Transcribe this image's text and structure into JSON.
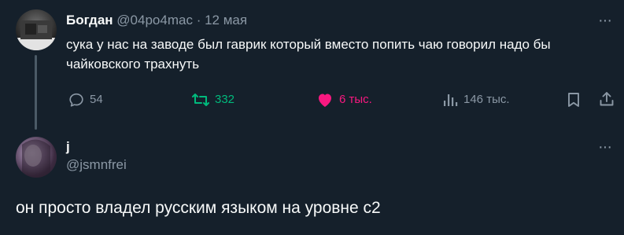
{
  "colors": {
    "background": "#15202b",
    "text_primary": "#f7f9f9",
    "text_muted": "#8b98a5",
    "retweet": "#00ba7c",
    "like": "#f91880",
    "thread_line": "#4b5a66"
  },
  "tweet": {
    "author_name": "Богдан",
    "author_handle": "@04po4mac",
    "separator": "·",
    "date": "12 мая",
    "more": "···",
    "text": "сука у нас на заводе был гаврик который вместо попить чаю говорил надо бы чайковского трахнуть",
    "actions": {
      "reply_icon": "reply-icon",
      "replies": "54",
      "retweet_icon": "retweet-icon",
      "retweets": "332",
      "like_icon": "heart-filled-icon",
      "likes": "6 тыс.",
      "views_icon": "views-chart-icon",
      "views": "146 тыс.",
      "bookmark_icon": "bookmark-icon",
      "share_icon": "share-icon"
    }
  },
  "reply": {
    "author_name": "j",
    "author_handle": "@jsmnfrei",
    "more": "···",
    "text": "он просто владел русским языком на уровне с2"
  }
}
